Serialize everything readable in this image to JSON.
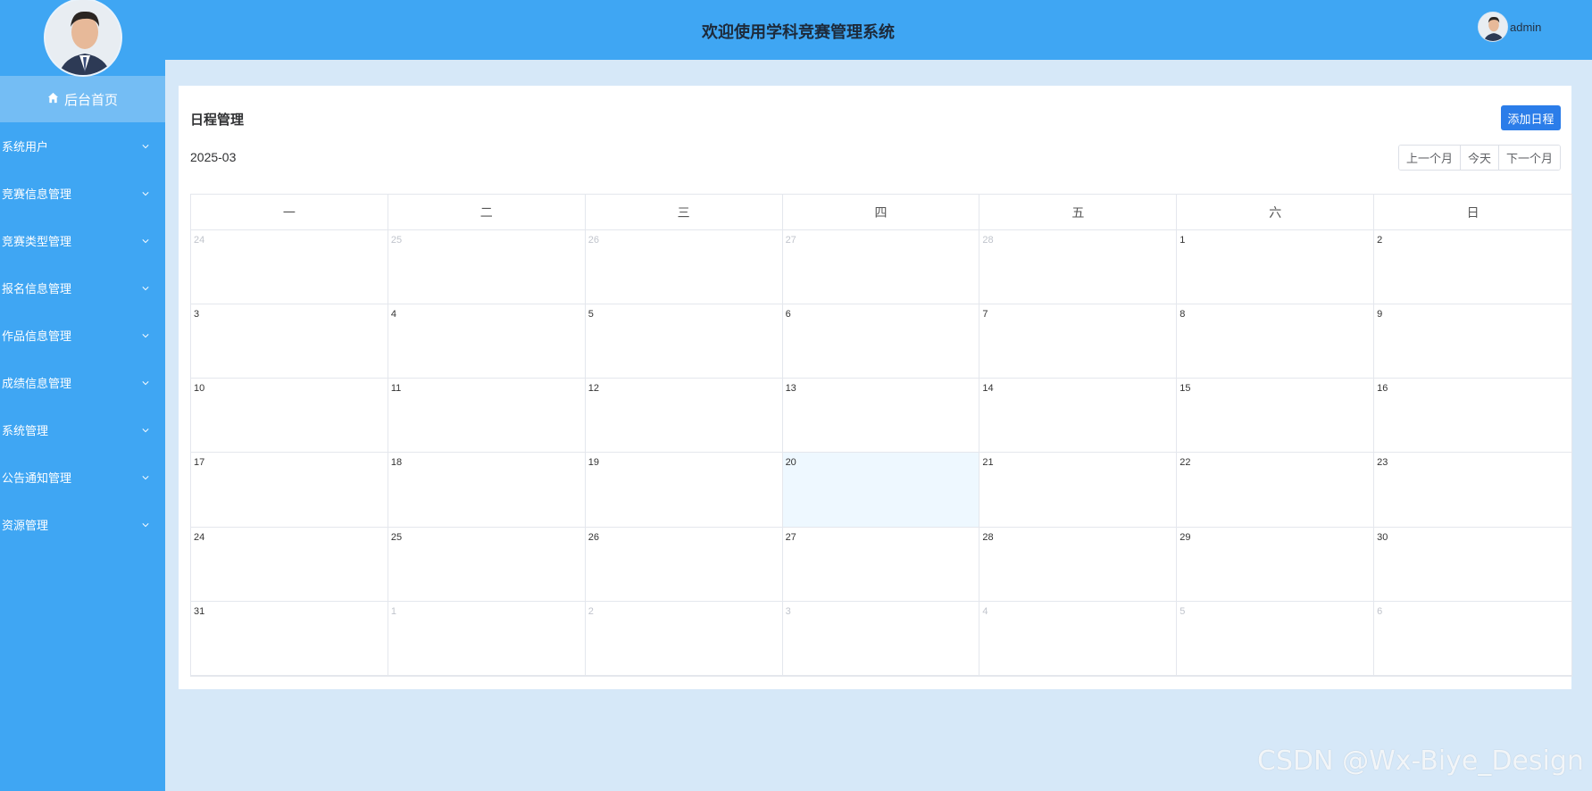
{
  "header": {
    "title": "欢迎使用学科竞赛管理系统",
    "user_name": "admin"
  },
  "sidebar": {
    "home_label": "后台首页",
    "items": [
      {
        "label": "系统用户"
      },
      {
        "label": "竞赛信息管理"
      },
      {
        "label": "竞赛类型管理"
      },
      {
        "label": "报名信息管理"
      },
      {
        "label": "作品信息管理"
      },
      {
        "label": "成绩信息管理"
      },
      {
        "label": "系统管理"
      },
      {
        "label": "公告通知管理"
      },
      {
        "label": "资源管理"
      }
    ]
  },
  "main": {
    "title": "日程管理",
    "add_button": "添加日程",
    "month": "2025-03",
    "nav": {
      "prev": "上一个月",
      "today": "今天",
      "next": "下一个月"
    },
    "weekdays": [
      "一",
      "二",
      "三",
      "四",
      "五",
      "六",
      "日"
    ],
    "days": [
      {
        "d": "24",
        "other": true
      },
      {
        "d": "25",
        "other": true
      },
      {
        "d": "26",
        "other": true
      },
      {
        "d": "27",
        "other": true
      },
      {
        "d": "28",
        "other": true
      },
      {
        "d": "1"
      },
      {
        "d": "2"
      },
      {
        "d": "3"
      },
      {
        "d": "4"
      },
      {
        "d": "5"
      },
      {
        "d": "6"
      },
      {
        "d": "7"
      },
      {
        "d": "8"
      },
      {
        "d": "9"
      },
      {
        "d": "10"
      },
      {
        "d": "11"
      },
      {
        "d": "12"
      },
      {
        "d": "13"
      },
      {
        "d": "14"
      },
      {
        "d": "15"
      },
      {
        "d": "16"
      },
      {
        "d": "17"
      },
      {
        "d": "18"
      },
      {
        "d": "19"
      },
      {
        "d": "20",
        "today": true
      },
      {
        "d": "21"
      },
      {
        "d": "22"
      },
      {
        "d": "23"
      },
      {
        "d": "24"
      },
      {
        "d": "25"
      },
      {
        "d": "26"
      },
      {
        "d": "27"
      },
      {
        "d": "28"
      },
      {
        "d": "29"
      },
      {
        "d": "30"
      },
      {
        "d": "31"
      },
      {
        "d": "1",
        "other": true
      },
      {
        "d": "2",
        "other": true
      },
      {
        "d": "3",
        "other": true
      },
      {
        "d": "4",
        "other": true
      },
      {
        "d": "5",
        "other": true
      },
      {
        "d": "6",
        "other": true
      }
    ]
  },
  "watermark": "CSDN @Wx-Biye_Design",
  "colors": {
    "sidebar_bg": "#3fa6f3",
    "home_bg": "#74bdf4",
    "accent_button": "#2b7de9",
    "today_bg": "#eef8ff"
  }
}
